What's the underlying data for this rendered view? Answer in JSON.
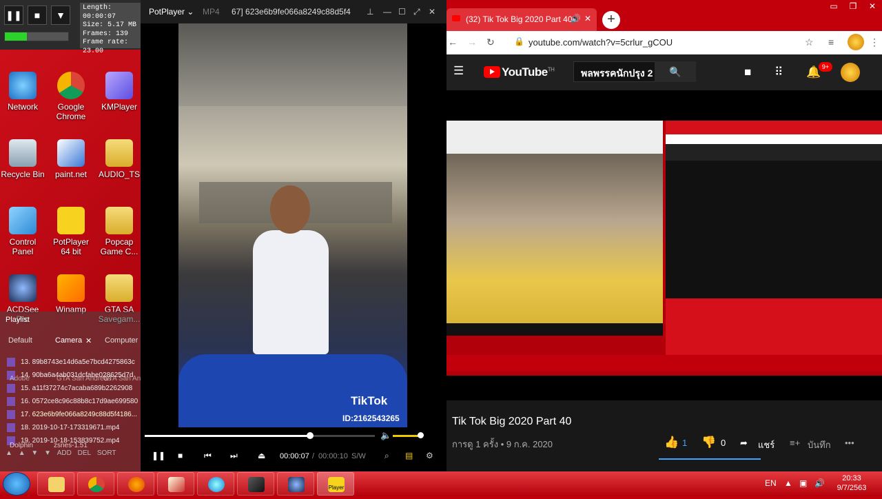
{
  "mini_player": {
    "info_lines": [
      "Length: 00:00:07",
      "Size: 5.17 MB",
      "Frames: 139",
      "Frame rate: 23.00"
    ],
    "level": 0.35
  },
  "desktop_icons": [
    {
      "label": "Network",
      "name": "network-icon"
    },
    {
      "label": "Google Chrome",
      "name": "chrome-icon"
    },
    {
      "label": "KMPlayer",
      "name": "kmplayer-icon"
    },
    {
      "label": "Recycle Bin",
      "name": "recycle-bin-icon"
    },
    {
      "label": "paint.net",
      "name": "paintnet-icon"
    },
    {
      "label": "AUDIO_TS",
      "name": "folder-icon"
    },
    {
      "label": "Control Panel",
      "name": "control-panel-icon"
    },
    {
      "label": "PotPlayer 64 bit",
      "name": "potplayer-icon"
    },
    {
      "label": "Popcap Game C...",
      "name": "folder-icon"
    },
    {
      "label": "ACDSee Pro",
      "name": "acdsee-icon"
    },
    {
      "label": "Winamp",
      "name": "winamp-icon"
    },
    {
      "label": "GTA SA Savegam...",
      "name": "folder-icon"
    }
  ],
  "playlist": {
    "title": "Playlist",
    "tabs": [
      "Default",
      "Camera",
      "Computer"
    ],
    "items": [
      "13. 89b8743e14d6a5e7bcd4275863c",
      "14. 90ba6a4ab031dcfabe028625d7d",
      "15. a11f37274c7acaba689b2262908",
      "16. 0572ce8c96c88b8c17d9ae699580",
      "17. 623e6b9fe066a8249c88d5f4186...",
      "18. 2019-10-17-173319671.mp4",
      "19. 2019-10-18-153839752.mp4"
    ],
    "shadow_labels": [
      "Adobe",
      "GTA San Andreas",
      "GTA San Andreas Cle",
      "Dolphin",
      "zsnes-1.51"
    ],
    "bottom_buttons": [
      "ADD",
      "DEL",
      "SORT"
    ]
  },
  "potplayer": {
    "app_name": "PotPlayer",
    "format": "MP4",
    "file_title": "67] 623e6b9fe066a8249c88d5f4",
    "tiktok_logo": "TikTok",
    "tiktok_id": "ID:2162543265",
    "time_current": "00:00:07",
    "time_sep": "/",
    "time_total": "00:00:10",
    "sw_label": "S/W",
    "seek_progress": 0.72,
    "volume": 0.9
  },
  "browser": {
    "tab_title": "(32) Tik Tok Big 2020 Part 40",
    "url": "youtube.com/watch?v=5crlur_gCOU",
    "youtube_logo": "YouTube",
    "youtube_sup": "TH",
    "search_value": "พลพรรคนักปรุง 2",
    "notif_badge": "9+",
    "video_title": "Tik Tok Big 2020 Part 40",
    "views_date": "การดู 1 ครั้ง • 9 ก.ค. 2020",
    "likes": "1",
    "dislikes": "0",
    "share": "แชร์",
    "save": "บันทึก",
    "more": "•••"
  },
  "taskbar": {
    "items": [
      "explorer",
      "chrome",
      "firefox",
      "paint",
      "ie",
      "winamp",
      "acdsee",
      "potplayer"
    ],
    "potplayer_label": "Player",
    "lang": "EN",
    "time": "20:33",
    "date": "9/7/2563"
  },
  "colors": {
    "desktop": "#c0000a",
    "youtube_red": "#ff0000",
    "accent_yellow": "#f0c800"
  }
}
